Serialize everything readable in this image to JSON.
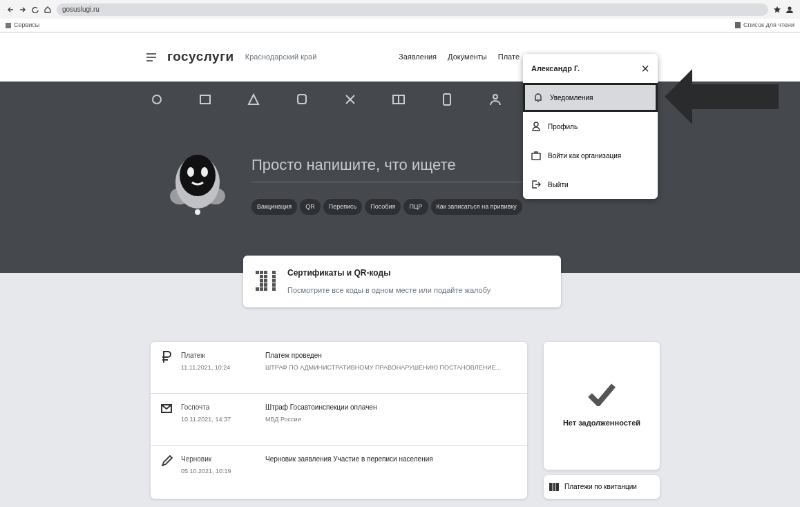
{
  "browser": {
    "url": "gosuslugi.ru",
    "bookmarks": "Сервисы",
    "reading_list": "Список для чтени"
  },
  "header": {
    "logo": "госуслуги",
    "region": "Краснодарский край",
    "nav": [
      "Заявления",
      "Документы",
      "Плате"
    ]
  },
  "user_menu": {
    "name": "Александр Г.",
    "close": "×",
    "items": [
      {
        "kind": "bell",
        "label": "Уведомления",
        "selected": true
      },
      {
        "kind": "person",
        "label": "Профиль",
        "selected": false
      },
      {
        "kind": "briefcase",
        "label": "Войти как организация",
        "selected": false
      },
      {
        "kind": "exit",
        "label": "Выйти",
        "selected": false
      }
    ]
  },
  "search": {
    "heading": "Просто напишите, что ищете",
    "chips": [
      "Вакцинация",
      "QR",
      "Перепись",
      "Пособия",
      "ПЦР",
      "Как записаться на прививку"
    ]
  },
  "qr_card": {
    "title": "Сертификаты и QR-коды",
    "text": "Посмотрите все коды в одном месте или подайте жалобу"
  },
  "feed": [
    {
      "kind": "payment",
      "type": "Платеж",
      "date": "11.11.2021, 10:24",
      "title": "Платеж проведен",
      "subtitle": "ШТРАФ ПО АДМИНИСТРАТИВНОМУ ПРАВОНАРУШЕНИЮ ПОСТАНОВЛЕНИЕ..."
    },
    {
      "kind": "mail",
      "type": "Госпочта",
      "date": "10.11.2021, 14:37",
      "title": "Штраф Госавтоинспекции оплачен",
      "subtitle": "МВД России"
    },
    {
      "kind": "draft",
      "type": "Черновик",
      "date": "05.10.2021, 10:19",
      "title": "Черновик заявления Участие в переписи населения"
    }
  ],
  "debt": {
    "text": "Нет задолженностей"
  },
  "receipt_button": "Платежи по квитанции"
}
